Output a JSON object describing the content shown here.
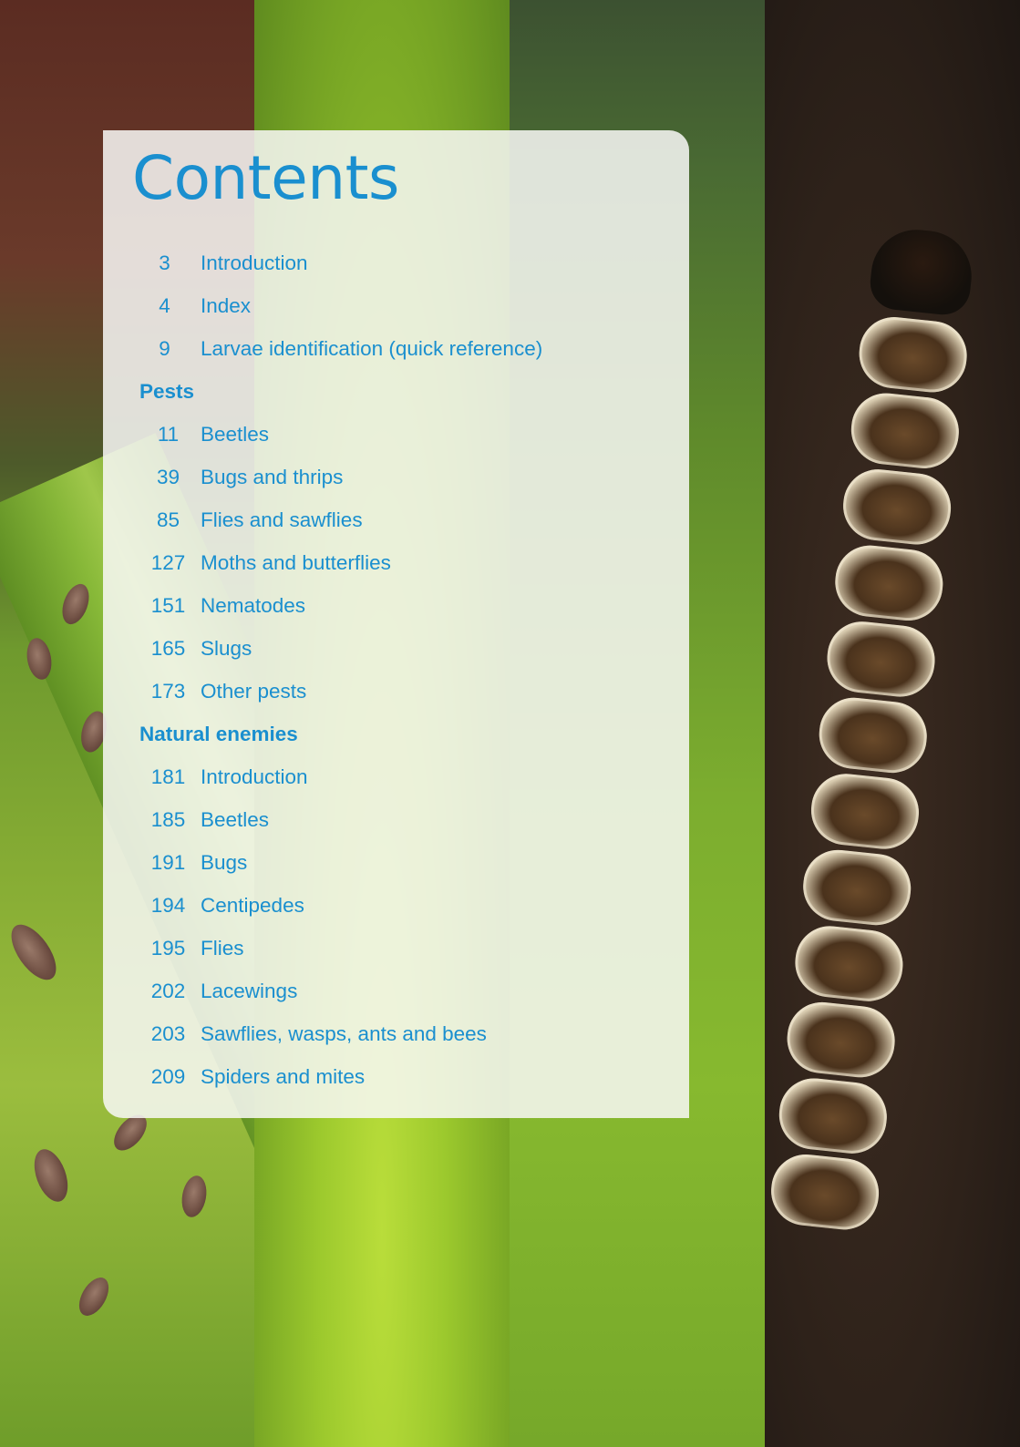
{
  "title": "Contents",
  "entries": [
    {
      "kind": "entry",
      "page": "3",
      "label": "Introduction"
    },
    {
      "kind": "entry",
      "page": "4",
      "label": "Index"
    },
    {
      "kind": "entry",
      "page": "9",
      "label": "Larvae identification (quick reference)"
    },
    {
      "kind": "section",
      "label": "Pests"
    },
    {
      "kind": "entry",
      "page": "11",
      "label": "Beetles"
    },
    {
      "kind": "entry",
      "page": "39",
      "label": "Bugs and thrips"
    },
    {
      "kind": "entry",
      "page": "85",
      "label": "Flies and sawflies"
    },
    {
      "kind": "entry",
      "page": "127",
      "label": "Moths and butterflies"
    },
    {
      "kind": "entry",
      "page": "151",
      "label": "Nematodes"
    },
    {
      "kind": "entry",
      "page": "165",
      "label": "Slugs"
    },
    {
      "kind": "entry",
      "page": "173",
      "label": "Other pests"
    },
    {
      "kind": "section",
      "label": "Natural enemies"
    },
    {
      "kind": "entry",
      "page": "181",
      "label": "Introduction"
    },
    {
      "kind": "entry",
      "page": "185",
      "label": "Beetles"
    },
    {
      "kind": "entry",
      "page": "191",
      "label": "Bugs"
    },
    {
      "kind": "entry",
      "page": "194",
      "label": "Centipedes"
    },
    {
      "kind": "entry",
      "page": "195",
      "label": "Flies"
    },
    {
      "kind": "entry",
      "page": "202",
      "label": "Lacewings"
    },
    {
      "kind": "entry",
      "page": "203",
      "label": "Sawflies, wasps, ants and bees"
    },
    {
      "kind": "entry",
      "page": "209",
      "label": "Spiders and mites"
    }
  ],
  "colors": {
    "accent": "#1a8fcf",
    "panel": "#f8f8f6"
  },
  "background_images": [
    "aphids-on-leaf-photo",
    "beetle-photo",
    "green-leaf-photo",
    "centipede-larva-photo"
  ]
}
